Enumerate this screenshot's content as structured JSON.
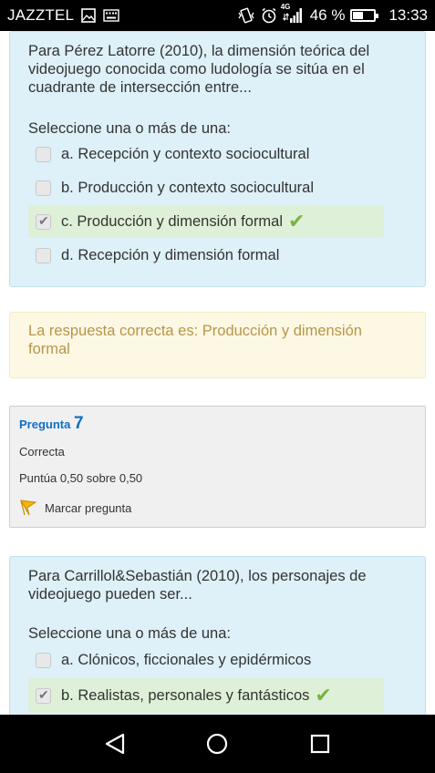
{
  "status_bar": {
    "carrier": "JAZZTEL",
    "network": "4G",
    "battery_percent": "46 %",
    "battery_level": 0.46,
    "time": "13:33"
  },
  "question6": {
    "text": "Para Pérez Latorre (2010), la dimensión teórica del videojuego conocida como ludología se sitúa en el cuadrante de intersección entre...",
    "prompt": "Seleccione una o más de una:",
    "options": [
      {
        "label": "a. Recepción y contexto sociocultural",
        "checked": false,
        "correct": false
      },
      {
        "label": "b. Producción y contexto sociocultural",
        "checked": false,
        "correct": false
      },
      {
        "label": "c. Producción y dimensión formal",
        "checked": true,
        "correct": true
      },
      {
        "label": "d. Recepción y dimensión formal",
        "checked": false,
        "correct": false
      }
    ],
    "feedback": "La respuesta correcta es: Producción y dimensión formal"
  },
  "question7_info": {
    "title": "Pregunta",
    "number": "7",
    "state": "Correcta",
    "grade": "Puntúa 0,50 sobre 0,50",
    "flag_label": "Marcar pregunta"
  },
  "question7": {
    "text": "Para Carrillol&Sebastián (2010), los personajes de videojuego pueden ser...",
    "prompt": "Seleccione una o más de una:",
    "options": [
      {
        "label": "a. Clónicos, ficcionales y epidérmicos",
        "checked": false,
        "correct": false
      },
      {
        "label": "b. Realistas, personales y fantásticos",
        "checked": true,
        "correct": true
      }
    ]
  },
  "colors": {
    "question_bg": "#def0f8",
    "correct_bg": "#dff0d8",
    "feedback_bg": "#fcf8e3",
    "feedback_text": "#b8954b",
    "link_blue": "#0f6fc5",
    "tick_green": "#7cb342"
  },
  "icons": [
    "image-icon",
    "keyboard-icon",
    "vibrate-icon",
    "alarm-icon",
    "signal-icon",
    "battery-icon",
    "back-icon",
    "home-icon",
    "recents-icon",
    "flag-icon",
    "checkmark-icon"
  ]
}
